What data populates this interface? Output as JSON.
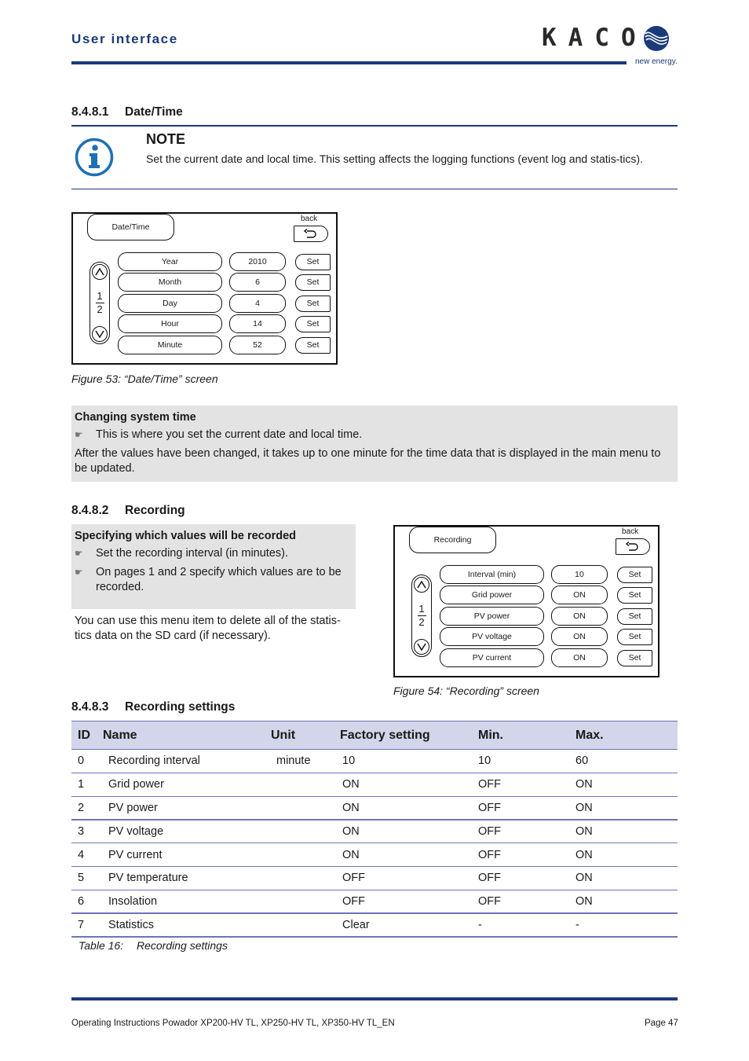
{
  "header": {
    "section_title": "User interface",
    "brand": {
      "name": "KACO",
      "tagline": "new energy.",
      "logo_icon": "wave-globe-icon",
      "color": "#1b3a7a"
    }
  },
  "sections": {
    "datetime": {
      "number": "8.4.8.1",
      "title": "Date/Time",
      "note": {
        "icon": "info-icon",
        "title": "NOTE",
        "text": "Set the current date and local time. This setting affects the logging functions (event log and statis-tics)."
      },
      "screen": {
        "title": "Date/Time",
        "back_label": "back",
        "back_icon": "return-arrow-icon",
        "pager": {
          "current": "1",
          "total": "2",
          "up_icon": "chevron-up-icon",
          "down_icon": "chevron-down-icon"
        },
        "rows": [
          {
            "label": "Year",
            "value": "2010",
            "action": "Set"
          },
          {
            "label": "Month",
            "value": "6",
            "action": "Set"
          },
          {
            "label": "Day",
            "value": "4",
            "action": "Set"
          },
          {
            "label": "Hour",
            "value": "14",
            "action": "Set"
          },
          {
            "label": "Minute",
            "value": "52",
            "action": "Set"
          }
        ]
      },
      "figure_caption": "Figure 53: “Date/Time” screen",
      "instructions": {
        "title": "Changing system time",
        "bullets": [
          "This is where you set the current date and local time."
        ],
        "text": "After the values have been changed, it takes up to one minute for the time data that is displayed in the main menu to be updated."
      }
    },
    "recording": {
      "number": "8.4.8.2",
      "title": "Recording",
      "instructions": {
        "title": "Specifying which values will be recorded",
        "bullets": [
          "Set the recording interval (in minutes).",
          "On pages 1 and 2 specify which values are to be recorded."
        ]
      },
      "text": "You can use this menu item to delete all of the statis-tics data on the SD card (if necessary).",
      "screen": {
        "title": "Recording",
        "back_label": "back",
        "back_icon": "return-arrow-icon",
        "pager": {
          "current": "1",
          "total": "2",
          "up_icon": "chevron-up-icon",
          "down_icon": "chevron-down-icon"
        },
        "rows": [
          {
            "label": "Interval (min)",
            "value": "10",
            "action": "Set"
          },
          {
            "label": "Grid power",
            "value": "ON",
            "action": "Set"
          },
          {
            "label": "PV power",
            "value": "ON",
            "action": "Set"
          },
          {
            "label": "PV voltage",
            "value": "ON",
            "action": "Set"
          },
          {
            "label": "PV current",
            "value": "ON",
            "action": "Set"
          }
        ]
      },
      "figure_caption": "Figure 54: “Recording” screen"
    },
    "recording_settings": {
      "number": "8.4.8.3",
      "title": "Recording settings",
      "table": {
        "headers": [
          "ID",
          "Name",
          "Unit",
          "Factory setting",
          "Min.",
          "Max."
        ],
        "rows": [
          [
            "0",
            "Recording interval",
            "minute",
            "10",
            "10",
            "60"
          ],
          [
            "1",
            "Grid power",
            "",
            "ON",
            "OFF",
            "ON"
          ],
          [
            "2",
            "PV power",
            "",
            "ON",
            "OFF",
            "ON"
          ],
          [
            "3",
            "PV voltage",
            "",
            "ON",
            "OFF",
            "ON"
          ],
          [
            "4",
            "PV current",
            "",
            "ON",
            "OFF",
            "ON"
          ],
          [
            "5",
            "PV temperature",
            "",
            "OFF",
            "OFF",
            "ON"
          ],
          [
            "6",
            "Insolation",
            "",
            "OFF",
            "OFF",
            "ON"
          ],
          [
            "7",
            "Statistics",
            "",
            "Clear",
            "-",
            "-"
          ]
        ],
        "caption_label": "Table 16:",
        "caption_text": "Recording settings"
      }
    }
  },
  "footer": {
    "document": "Operating Instructions Powador XP200-HV TL, XP250-HV TL, XP350-HV TL_EN",
    "page": "Page 47"
  }
}
